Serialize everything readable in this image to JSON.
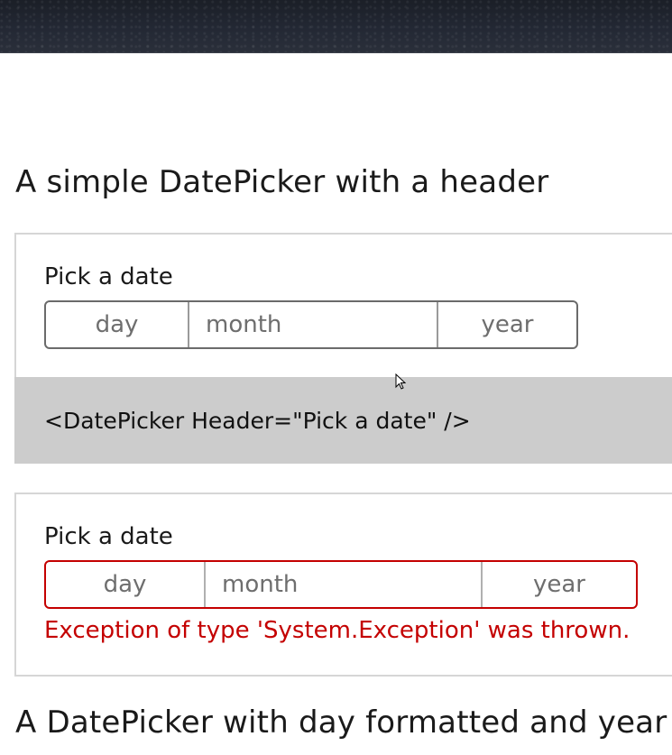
{
  "sections": [
    {
      "title": "A simple DatePicker with a header",
      "label": "Pick a date",
      "placeholders": {
        "day": "day",
        "month": "month",
        "year": "year"
      },
      "code": "<DatePicker Header=\"Pick a date\" />"
    },
    {
      "label": "Pick a date",
      "placeholders": {
        "day": "day",
        "month": "month",
        "year": "year"
      },
      "error": "Exception of type 'System.Exception' was thrown."
    },
    {
      "title": "A DatePicker with day formatted and year h"
    }
  ],
  "colors": {
    "error": "#c40000",
    "code_background": "#cccccc",
    "border": "#d6d6d6"
  }
}
